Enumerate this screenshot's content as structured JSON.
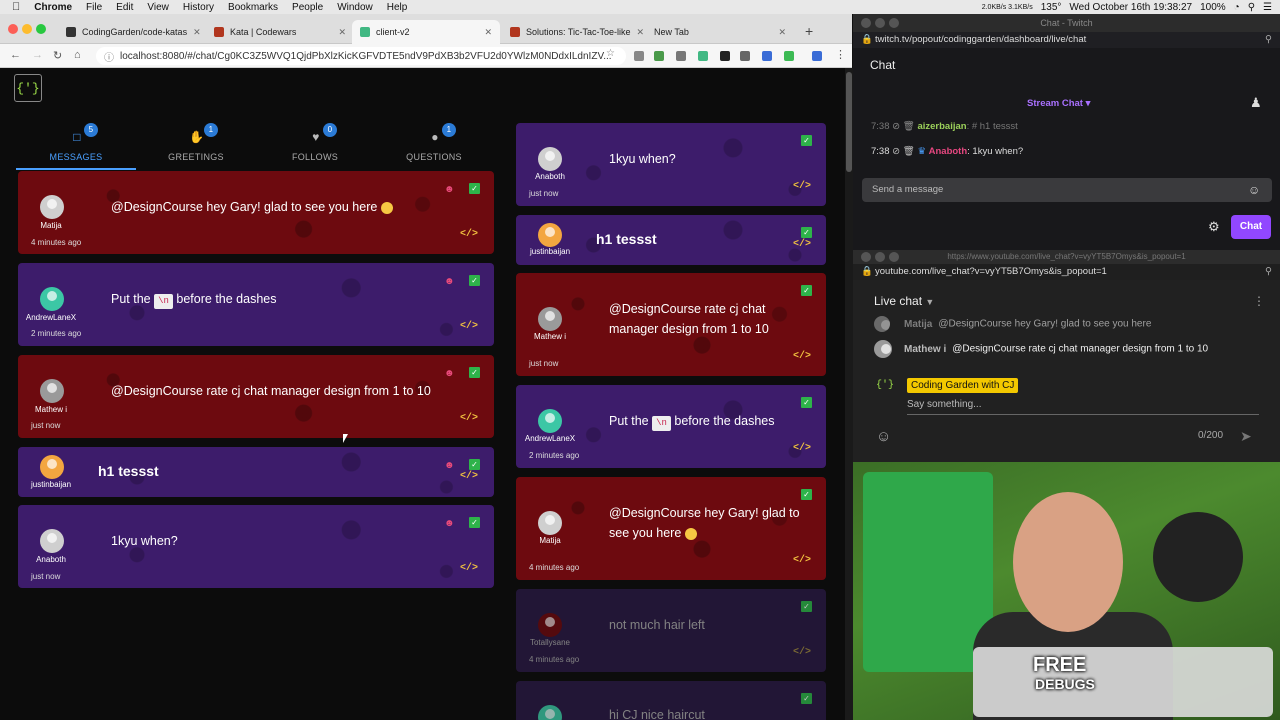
{
  "menubar": {
    "app": "Chrome",
    "items": [
      "File",
      "Edit",
      "View",
      "History",
      "Bookmarks",
      "People",
      "Window",
      "Help"
    ],
    "net": "2.0KB/s 3.1KB/s",
    "temp": "135°",
    "datetime": "Wed October 16th 19:38:27",
    "battery": "100%"
  },
  "browser": {
    "tabs": [
      {
        "title": "CodingGarden/code-katas",
        "color": "#333333"
      },
      {
        "title": "Kata | Codewars",
        "color": "#b1361e"
      },
      {
        "title": "client-v2",
        "color": "#41b883"
      },
      {
        "title": "Solutions: Tic-Tac-Toe-like",
        "color": "#b1361e"
      },
      {
        "title": "New Tab",
        "color": ""
      }
    ],
    "url": "localhost:8080/#/chat/Cg0KC3Z5WVQ1QjdPbXlzKicKGFVDTE5ndV9PdXB3b2VFU2d0YWlzM0NDdxILdnIZV..."
  },
  "app": {
    "logo": "{'}",
    "nav_tabs": [
      {
        "label": "MESSAGES",
        "count": "5",
        "icon": "chat-icon"
      },
      {
        "label": "GREETINGS",
        "count": "1",
        "icon": "wave-icon"
      },
      {
        "label": "FOLLOWS",
        "count": "0",
        "icon": "heart-icon"
      },
      {
        "label": "QUESTIONS",
        "count": "1",
        "icon": "question-user-icon"
      }
    ],
    "left_cards": [
      {
        "user": "Matija",
        "time": "4 minutes ago",
        "text": "@DesignCourse hey Gary! glad to see you here"
      },
      {
        "user": "AndrewLaneX",
        "time": "2 minutes ago",
        "pre": "Put the",
        "code": "\\n",
        "post": "before the dashes"
      },
      {
        "user": "Mathew i",
        "time": "just now",
        "text": "@DesignCourse rate cj chat manager design from 1 to 10"
      },
      {
        "user": "justinbaijan",
        "time": "",
        "text": "h1 tessst"
      },
      {
        "user": "Anaboth",
        "time": "just now",
        "text": "1kyu when?"
      }
    ],
    "right_cards": [
      {
        "user": "Anaboth",
        "time": "just now",
        "text": "1kyu when?"
      },
      {
        "user": "justinbaijan",
        "time": "",
        "text": "h1 tessst"
      },
      {
        "user": "Mathew i",
        "time": "just now",
        "text": "@DesignCourse rate cj chat manager design from 1 to 10"
      },
      {
        "user": "AndrewLaneX",
        "time": "2 minutes ago",
        "pre": "Put the",
        "code": "\\n",
        "post": "before the dashes"
      },
      {
        "user": "Matija",
        "time": "4 minutes ago",
        "text": "@DesignCourse hey Gary! glad to see you here"
      },
      {
        "user": "Totallysane",
        "time": "4 minutes ago",
        "text": "not much hair left"
      },
      {
        "user": "",
        "time": "",
        "text": "hi CJ nice haircut"
      }
    ]
  },
  "twitch": {
    "window_title": "Chat - Twitch",
    "url": "twitch.tv/popout/codinggarden/dashboard/live/chat",
    "title": "Chat",
    "stream_chat": "Stream Chat",
    "lines": [
      {
        "time": "7:38",
        "name": "aizerbaijan",
        "text": ": # h1 tessst"
      },
      {
        "time": "7:38",
        "name": "Anaboth",
        "text": ": 1kyu when?"
      }
    ],
    "input_placeholder": "Send a message",
    "chat_button": "Chat"
  },
  "youtube": {
    "window_title": "https://www.youtube.com/live_chat?v=vyYT5B7Omys&is_popout=1",
    "url": "youtube.com/live_chat?v=vyYT5B7Omys&is_popout=1",
    "title": "Live chat",
    "lines": [
      {
        "name": "Matija",
        "text": "@DesignCourse hey Gary! glad to see you here"
      },
      {
        "name": "Mathew i",
        "text": "@DesignCourse rate cj chat manager design from 1 to 10"
      }
    ],
    "channel": "Coding Garden with CJ",
    "placeholder": "Say something...",
    "count": "0/200"
  },
  "webcam": {
    "sticker_line1": "FREE",
    "sticker_line2": "DEBUGS"
  }
}
